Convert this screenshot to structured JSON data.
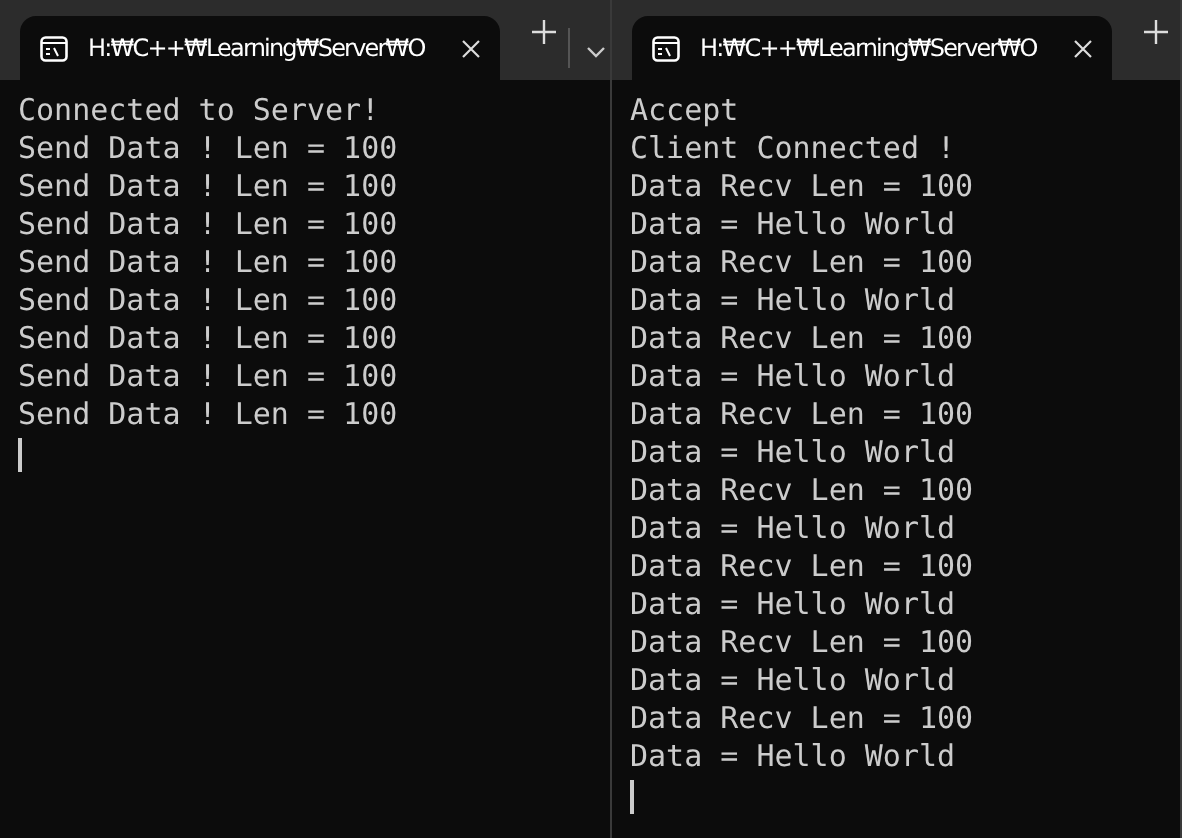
{
  "windows": [
    {
      "tab": {
        "title": "H:₩C++₩Learning₩Server₩O",
        "selected": true
      },
      "dropdown": true,
      "cursor": true,
      "lines": [
        "Connected to Server!",
        "Send Data ! Len = 100",
        "Send Data ! Len = 100",
        "Send Data ! Len = 100",
        "Send Data ! Len = 100",
        "Send Data ! Len = 100",
        "Send Data ! Len = 100",
        "Send Data ! Len = 100",
        "Send Data ! Len = 100"
      ]
    },
    {
      "tab": {
        "title": "H:₩C++₩Learning₩Server₩O",
        "selected": true
      },
      "dropdown": false,
      "cursor": true,
      "lines": [
        "Accept",
        "Client Connected !",
        "Data Recv Len = 100",
        "Data = Hello World",
        "Data Recv Len = 100",
        "Data = Hello World",
        "Data Recv Len = 100",
        "Data = Hello World",
        "Data Recv Len = 100",
        "Data = Hello World",
        "Data Recv Len = 100",
        "Data = Hello World",
        "Data Recv Len = 100",
        "Data = Hello World",
        "Data Recv Len = 100",
        "Data = Hello World",
        "Data Recv Len = 100",
        "Data = Hello World"
      ]
    }
  ]
}
